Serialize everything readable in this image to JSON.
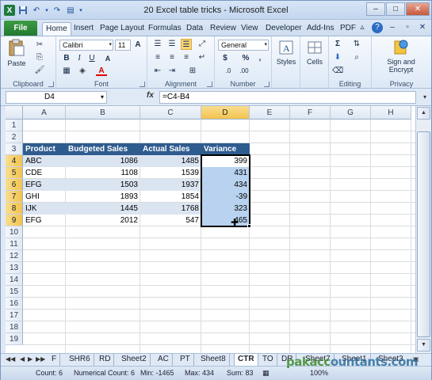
{
  "window": {
    "title": "20 Excel table tricks - Microsoft Excel",
    "buttons": {
      "minimize": "–",
      "maximize": "□",
      "close": "✕"
    }
  },
  "qat": {
    "app_icon": "X",
    "save_icon": "save-icon",
    "undo_icon": "undo-icon",
    "redo_icon": "redo-icon"
  },
  "ribbon_tabs": [
    "Home",
    "Insert",
    "Page Layout",
    "Formulas",
    "Data",
    "Review",
    "View",
    "Developer",
    "Add-Ins",
    "PDF"
  ],
  "file_tab": "File",
  "active_tab": "Home",
  "clipboard": {
    "paste": "Paste",
    "label": "Clipboard"
  },
  "font": {
    "name": "Calibri",
    "size": "11",
    "label": "Font",
    "bold": "B",
    "italic": "I",
    "underline": "U",
    "grow": "A",
    "shrink": "A",
    "color_letter": "A"
  },
  "alignment": {
    "label": "Alignment"
  },
  "number": {
    "format": "General",
    "currency": "$",
    "percent": "%",
    "comma": ",",
    "label": "Number"
  },
  "styles": {
    "label": "Styles"
  },
  "cells": {
    "label": "Cells"
  },
  "editing": {
    "label": "Editing",
    "sum": "Σ"
  },
  "privacy": {
    "sign": "Sign and",
    "encrypt": "Encrypt",
    "label": "Privacy"
  },
  "formula_bar": {
    "name_box": "D4",
    "fx": "fx",
    "formula": "=C4-B4"
  },
  "columns": [
    "A",
    "B",
    "C",
    "D",
    "E",
    "F",
    "G",
    "H"
  ],
  "rows": [
    "1",
    "2",
    "3",
    "4",
    "5",
    "6",
    "7",
    "8",
    "9",
    "10",
    "11",
    "12",
    "13",
    "14",
    "15",
    "16",
    "17",
    "18",
    "19"
  ],
  "table": {
    "headers": [
      "Product",
      "Budgeted Sales",
      "Actual Sales",
      "Variance"
    ],
    "rows": [
      [
        "ABC",
        "1086",
        "1485",
        "399"
      ],
      [
        "CDE",
        "1108",
        "1539",
        "431"
      ],
      [
        "EFG",
        "1503",
        "1937",
        "434"
      ],
      [
        "GHI",
        "1893",
        "1854",
        "-39"
      ],
      [
        "IJK",
        "1445",
        "1768",
        "323"
      ],
      [
        "EFG",
        "2012",
        "547",
        "465"
      ]
    ]
  },
  "sheets": [
    "F",
    "SHR6",
    "RD",
    "Sheet2",
    "AC",
    "PT",
    "Sheet8",
    "CTR",
    "TO",
    "DR",
    "Sheet7",
    "Sheet1",
    "Sheet3"
  ],
  "active_sheet": "CTR",
  "status": {
    "count": "Count: 6",
    "numerical_count": "Numerical Count: 6",
    "min": "Min: -1465",
    "max": "Max: 434",
    "sum": "Sum: 83",
    "zoom": "100%"
  },
  "watermark": {
    "part1": "pakacc",
    "part2": "ountants.com"
  },
  "colors": {
    "table_header": "#2f5c8f",
    "band": "#dbe5f1",
    "selection": "#b8d2ef",
    "file_tab": "#227a2e"
  }
}
